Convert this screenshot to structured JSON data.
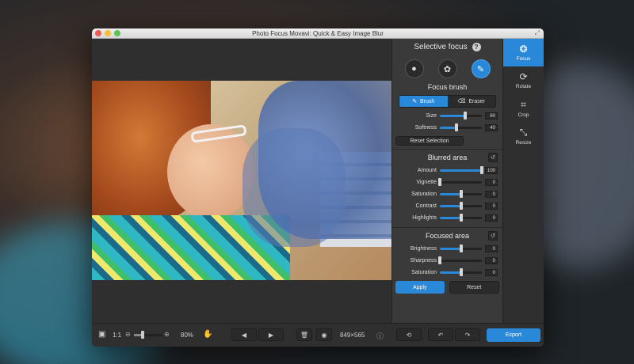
{
  "window": {
    "title": "Photo Focus Movavi: Quick & Easy Image Blur"
  },
  "panel": {
    "header": "Selective focus",
    "modes": [
      {
        "icon": "person-icon"
      },
      {
        "icon": "flower-icon"
      },
      {
        "icon": "brush-icon",
        "active": true
      }
    ],
    "focus_brush_title": "Focus brush",
    "brush_tabs": [
      {
        "label": "Brush",
        "active": true
      },
      {
        "label": "Eraser",
        "active": false
      }
    ],
    "brush_sliders": [
      {
        "label": "Size",
        "value": "60",
        "pct": 0.6
      },
      {
        "label": "Softness",
        "value": "40",
        "pct": 0.4
      }
    ],
    "reset_selection": "Reset Selection",
    "blurred_title": "Blurred area",
    "blurred_sliders": [
      {
        "label": "Amount",
        "value": "100",
        "pct": 1.0
      },
      {
        "label": "Vignette",
        "value": "0",
        "pct": 0.0
      },
      {
        "label": "Saturation",
        "value": "0",
        "pct": 0.5
      },
      {
        "label": "Contrast",
        "value": "0",
        "pct": 0.5
      },
      {
        "label": "Highlights",
        "value": "0",
        "pct": 0.5
      }
    ],
    "focused_title": "Focused area",
    "focused_sliders": [
      {
        "label": "Brightness",
        "value": "0",
        "pct": 0.5
      },
      {
        "label": "Sharpness",
        "value": "0",
        "pct": 0.0
      },
      {
        "label": "Saturation",
        "value": "0",
        "pct": 0.5
      }
    ],
    "apply": "Apply",
    "reset": "Reset"
  },
  "tools": [
    {
      "label": "Focus",
      "icon": "aperture-icon",
      "active": true
    },
    {
      "label": "Rotate",
      "icon": "rotate-icon",
      "active": false
    },
    {
      "label": "Crop",
      "icon": "crop-icon",
      "active": false
    },
    {
      "label": "Resize",
      "icon": "resize-icon",
      "active": false
    }
  ],
  "bottom": {
    "ratio": "1:1",
    "zoom": "80%",
    "dimensions": "849×565",
    "export": "Export",
    "zoom_level": 0.3
  },
  "colors": {
    "accent": "#2a88d9"
  }
}
